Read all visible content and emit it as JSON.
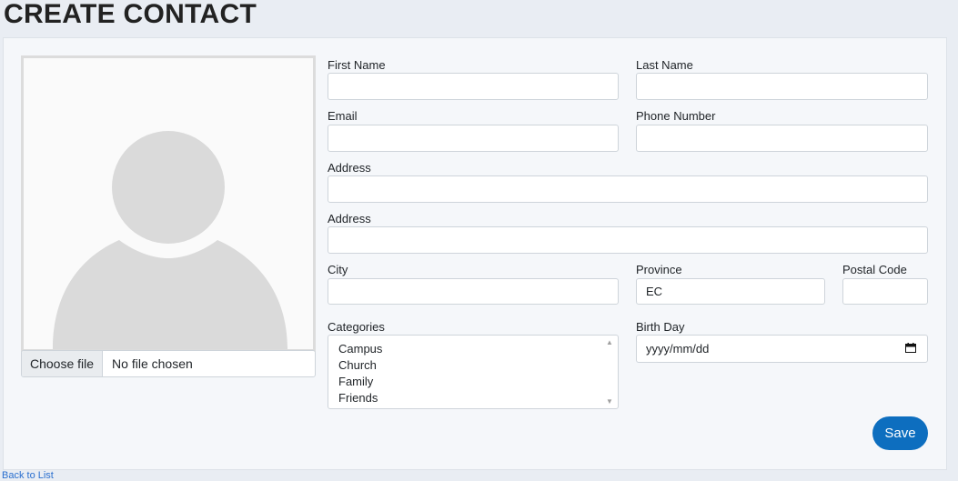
{
  "page": {
    "title": "CREATE CONTACT"
  },
  "photo": {
    "choose_file_label": "Choose file",
    "file_status": "No file chosen"
  },
  "form": {
    "first_name": {
      "label": "First Name",
      "value": ""
    },
    "last_name": {
      "label": "Last Name",
      "value": ""
    },
    "email": {
      "label": "Email",
      "value": ""
    },
    "phone": {
      "label": "Phone Number",
      "value": ""
    },
    "address1": {
      "label": "Address",
      "value": ""
    },
    "address2": {
      "label": "Address",
      "value": ""
    },
    "city": {
      "label": "City",
      "value": ""
    },
    "province": {
      "label": "Province",
      "value": "EC"
    },
    "postal_code": {
      "label": "Postal Code",
      "value": ""
    },
    "categories": {
      "label": "Categories",
      "options": [
        "Campus",
        "Church",
        "Family",
        "Friends"
      ]
    },
    "birthday": {
      "label": "Birth Day",
      "placeholder": "yyyy/mm/dd"
    }
  },
  "actions": {
    "save_label": "Save"
  },
  "footer": {
    "back_link": "Back to List"
  },
  "colors": {
    "primary": "#0d6ebf",
    "card_bg": "#f5f7fa",
    "page_bg": "#e9edf3"
  }
}
